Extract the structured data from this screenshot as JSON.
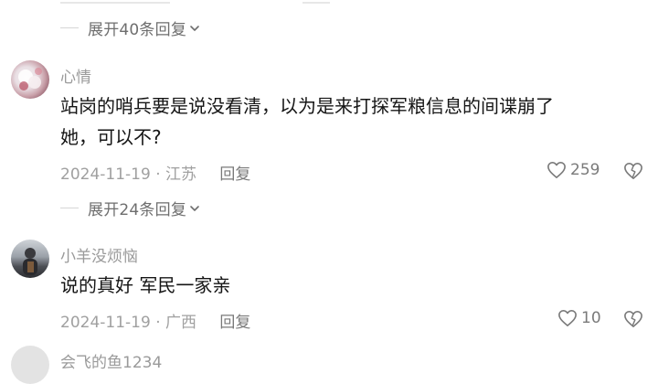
{
  "top": {
    "expand_label": "展开40条回复"
  },
  "comments": [
    {
      "username": "心情",
      "text_line1": "站岗的哨兵要是说没看清，以为是来打探军粮信息的间谍崩了",
      "text_line2": "她，可以不?",
      "date": "2024-11-19",
      "location": "江苏",
      "reply_label": "回复",
      "likes": "259",
      "expand_label": "展开24条回复"
    },
    {
      "username": "小羊没烦恼",
      "text_line1": "说的真好 军民一家亲",
      "date": "2024-11-19",
      "location": "广西",
      "reply_label": "回复",
      "likes": "10"
    },
    {
      "username": "会飞的鱼1234"
    }
  ],
  "meta_separator": "·",
  "colors": {
    "text": "#151515",
    "muted": "#9a9a9a",
    "divider": "#d6d6d6"
  }
}
